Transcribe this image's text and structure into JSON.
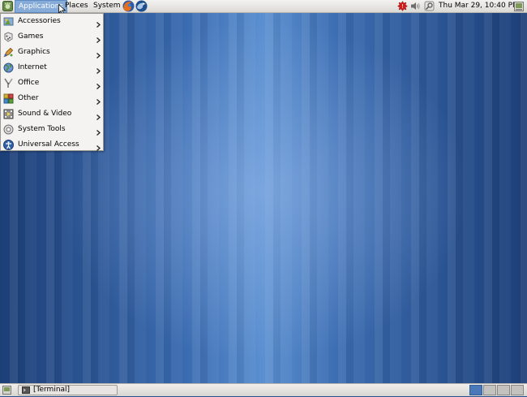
{
  "top_panel": {
    "menus": [
      "Applications",
      "Places",
      "System"
    ],
    "clock": "Thu Mar 29, 10:40 PM",
    "icons": {
      "foot": "gnome-foot-icon",
      "firefox": "firefox-icon",
      "thunderbird": "thunderbird-icon",
      "updates": "update-alert-icon",
      "volume": "volume-icon",
      "network": "network-icon",
      "show_desktop": "show-desktop-icon"
    }
  },
  "apps_menu": {
    "items": [
      {
        "label": "Accessories",
        "icon": "accessories-icon"
      },
      {
        "label": "Games",
        "icon": "games-icon"
      },
      {
        "label": "Graphics",
        "icon": "graphics-icon"
      },
      {
        "label": "Internet",
        "icon": "internet-icon"
      },
      {
        "label": "Office",
        "icon": "office-icon"
      },
      {
        "label": "Other",
        "icon": "other-icon"
      },
      {
        "label": "Sound & Video",
        "icon": "sound-video-icon"
      },
      {
        "label": "System Tools",
        "icon": "system-tools-icon"
      },
      {
        "label": "Universal Access",
        "icon": "universal-access-icon"
      }
    ]
  },
  "bottom_panel": {
    "task": "[Terminal]",
    "workspaces": 4,
    "active_workspace": 1
  },
  "colors": {
    "menu_highlight": "#86abd9",
    "desktop_blue": "#3a6bb0"
  }
}
